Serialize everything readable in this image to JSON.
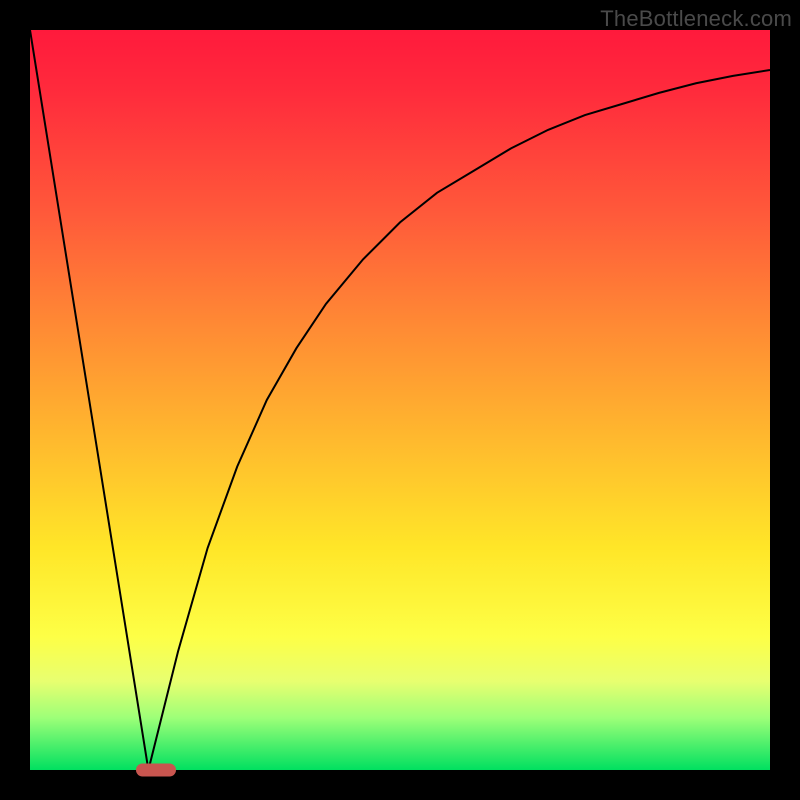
{
  "watermark": "TheBottleneck.com",
  "colors": {
    "curve": "#000000",
    "marker": "#c8554f",
    "frame": "#000000"
  },
  "chart_data": {
    "type": "line",
    "title": "",
    "xlabel": "",
    "ylabel": "",
    "xlim": [
      0,
      100
    ],
    "ylim": [
      0,
      100
    ],
    "grid": false,
    "legend": false,
    "series": [
      {
        "name": "left-branch",
        "x": [
          0,
          4,
          8,
          12,
          16
        ],
        "y": [
          100,
          75,
          50,
          25,
          0
        ]
      },
      {
        "name": "right-branch",
        "x": [
          16,
          20,
          24,
          28,
          32,
          36,
          40,
          45,
          50,
          55,
          60,
          65,
          70,
          75,
          80,
          85,
          90,
          95,
          100
        ],
        "y": [
          0,
          16,
          30,
          41,
          50,
          57,
          63,
          69,
          74,
          78,
          81,
          84,
          86.5,
          88.5,
          90,
          91.5,
          92.8,
          93.8,
          94.6
        ]
      }
    ],
    "annotations": [
      {
        "name": "optimal-marker",
        "x": 17,
        "y": 0
      }
    ]
  }
}
